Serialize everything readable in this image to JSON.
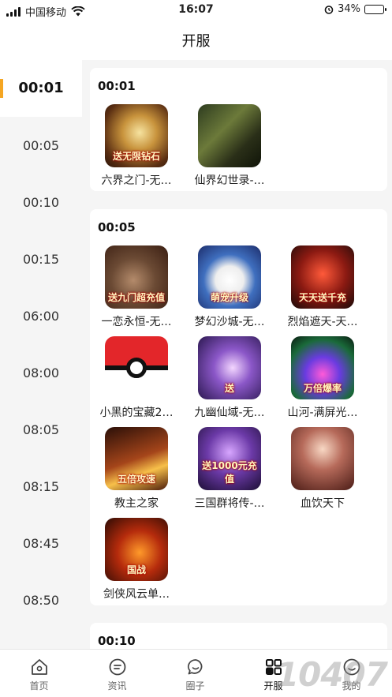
{
  "status_bar": {
    "carrier": "中国移动",
    "time": "16:07",
    "battery": "34%",
    "battery_level": 0.34
  },
  "nav": {
    "title": "开服"
  },
  "sidebar": {
    "items": [
      {
        "label": "00:01",
        "active": true
      },
      {
        "label": "00:05"
      },
      {
        "label": "00:10"
      },
      {
        "label": "00:15"
      },
      {
        "label": "06:00"
      },
      {
        "label": "08:00"
      },
      {
        "label": "08:05"
      },
      {
        "label": "08:15"
      },
      {
        "label": "08:45"
      },
      {
        "label": "08:50"
      }
    ]
  },
  "sections": [
    {
      "time": "00:01",
      "games": [
        {
          "name": "六界之门-无…",
          "icon": "crystal-warrior-icon",
          "badge": "送无限钻石"
        },
        {
          "name": "仙界幻世录-…",
          "icon": "sword-scroll-icon"
        }
      ]
    },
    {
      "time": "00:05",
      "games": [
        {
          "name": "一恋永恒-无…",
          "icon": "beast-warrior-icon",
          "badge": "送九门超充值"
        },
        {
          "name": "梦幻沙城-无…",
          "icon": "panda-icon",
          "badge": "萌宠升级"
        },
        {
          "name": "烈焰遮天-天…",
          "icon": "fire-warrior-icon",
          "badge": "天天送千充"
        },
        {
          "name": "小黑的宝藏2…",
          "icon": "pokeball-icon"
        },
        {
          "name": "九幽仙域-无…",
          "icon": "fairy-icon",
          "badge": "送"
        },
        {
          "name": "山河-满屏光…",
          "icon": "neon-warrior-icon",
          "badge": "万倍爆率"
        },
        {
          "name": "教主之家",
          "icon": "golden-sword-icon",
          "badge": "五倍攻速"
        },
        {
          "name": "三国群将传-…",
          "icon": "purple-hero-icon",
          "badge": "送1000元充值"
        },
        {
          "name": "血饮天下",
          "icon": "lady-portrait-icon"
        },
        {
          "name": "剑侠风云单…",
          "icon": "fire-dragon-icon",
          "badge": "国战"
        }
      ]
    },
    {
      "time": "00:10",
      "games": []
    }
  ],
  "tabs": [
    {
      "label": "首页",
      "icon": "home-icon"
    },
    {
      "label": "资讯",
      "icon": "news-icon"
    },
    {
      "label": "圈子",
      "icon": "chat-icon"
    },
    {
      "label": "开服",
      "icon": "grid-icon",
      "active": true
    },
    {
      "label": "我的",
      "icon": "profile-icon"
    }
  ],
  "watermark": "10407"
}
